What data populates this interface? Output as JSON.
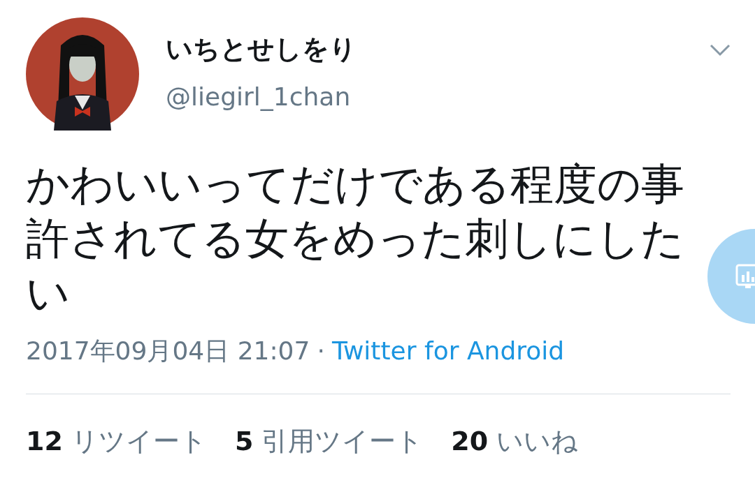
{
  "author": {
    "name": "いちとせしをり",
    "handle": "@liegirl_1chan"
  },
  "tweet": {
    "text": "かわいいってだけである程度の事許されてる女をめった刺しにしたい",
    "timestamp": "2017年09月04日 21:07",
    "separator": "·",
    "source": "Twitter for Android"
  },
  "stats": [
    {
      "count": "12",
      "label": "リツイート"
    },
    {
      "count": "5",
      "label": "引用ツイート"
    },
    {
      "count": "20",
      "label": "いいね"
    }
  ]
}
